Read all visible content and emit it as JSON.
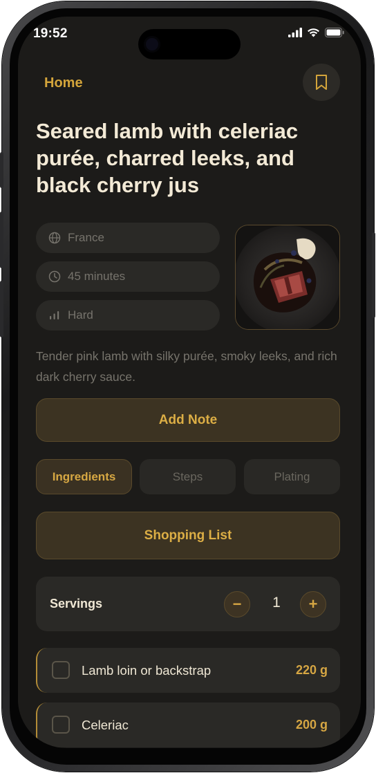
{
  "status_bar": {
    "time": "19:52"
  },
  "header": {
    "back_label": "Home"
  },
  "recipe": {
    "title": "Seared lamb with celeriac purée, charred leeks, and black cherry jus",
    "meta": {
      "origin": "France",
      "duration": "45 minutes",
      "difficulty": "Hard"
    },
    "description": "Tender pink lamb with silky purée, smoky leeks, and rich dark cherry sauce."
  },
  "actions": {
    "add_note_label": "Add Note",
    "shopping_list_label": "Shopping List"
  },
  "tabs": [
    {
      "label": "Ingredients",
      "active": true
    },
    {
      "label": "Steps",
      "active": false
    },
    {
      "label": "Plating",
      "active": false
    }
  ],
  "servings": {
    "label": "Servings",
    "count": "1",
    "decrement": "−",
    "increment": "+"
  },
  "ingredients": [
    {
      "name": "Lamb loin or backstrap",
      "amount": "220 g",
      "checked": false
    },
    {
      "name": "Celeriac",
      "amount": "200 g",
      "checked": false
    }
  ],
  "colors": {
    "background": "#1c1b19",
    "accent": "#d6a643",
    "card": "#2a2926",
    "accent_surface": "#3c3322"
  },
  "icons": [
    "bookmark-icon",
    "globe-icon",
    "clock-icon",
    "bars-icon",
    "signal-icon",
    "wifi-icon",
    "battery-icon",
    "minus-icon",
    "plus-icon"
  ]
}
